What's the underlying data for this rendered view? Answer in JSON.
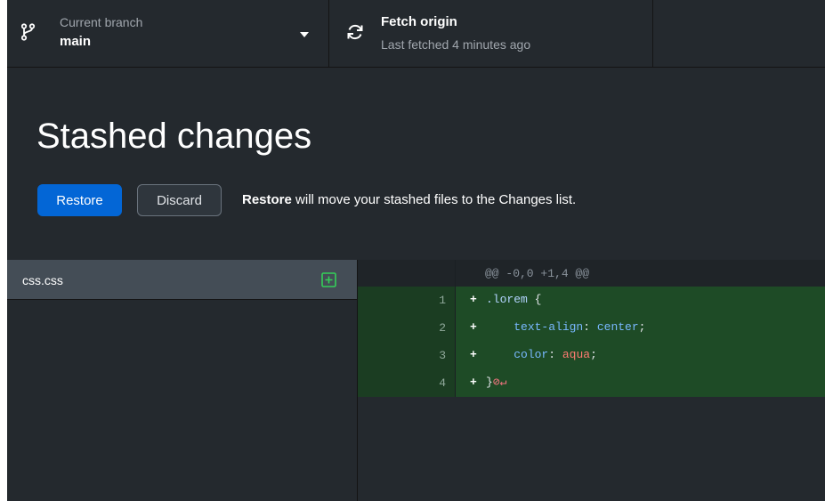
{
  "toolbar": {
    "branch": {
      "label": "Current branch",
      "value": "main"
    },
    "fetch": {
      "title": "Fetch origin",
      "status": "Last fetched 4 minutes ago"
    }
  },
  "stash": {
    "title": "Stashed changes",
    "restore_label": "Restore",
    "discard_label": "Discard",
    "desc_bold": "Restore",
    "desc_rest": " will move your stashed files to the Changes list."
  },
  "files": [
    {
      "name": "css.css",
      "status_icon": "file-added-icon"
    }
  ],
  "diff": {
    "hunk": "@@ -0,0 +1,4 @@",
    "lines": [
      {
        "num": "1",
        "sign": "+",
        "parts": [
          ".lorem",
          " {"
        ]
      },
      {
        "num": "2",
        "sign": "+",
        "parts": [
          "    ",
          "text-align",
          ": ",
          "center",
          ";"
        ]
      },
      {
        "num": "3",
        "sign": "+",
        "parts": [
          "    ",
          "color",
          ": ",
          "aqua",
          ";"
        ]
      },
      {
        "num": "4",
        "sign": "+",
        "parts": [
          "}"
        ],
        "no_newline_icons": "⊘↵"
      }
    ]
  },
  "colors": {
    "accent": "#0366d6",
    "added_bg": "#1e4b26",
    "added_icon": "#34d058"
  }
}
